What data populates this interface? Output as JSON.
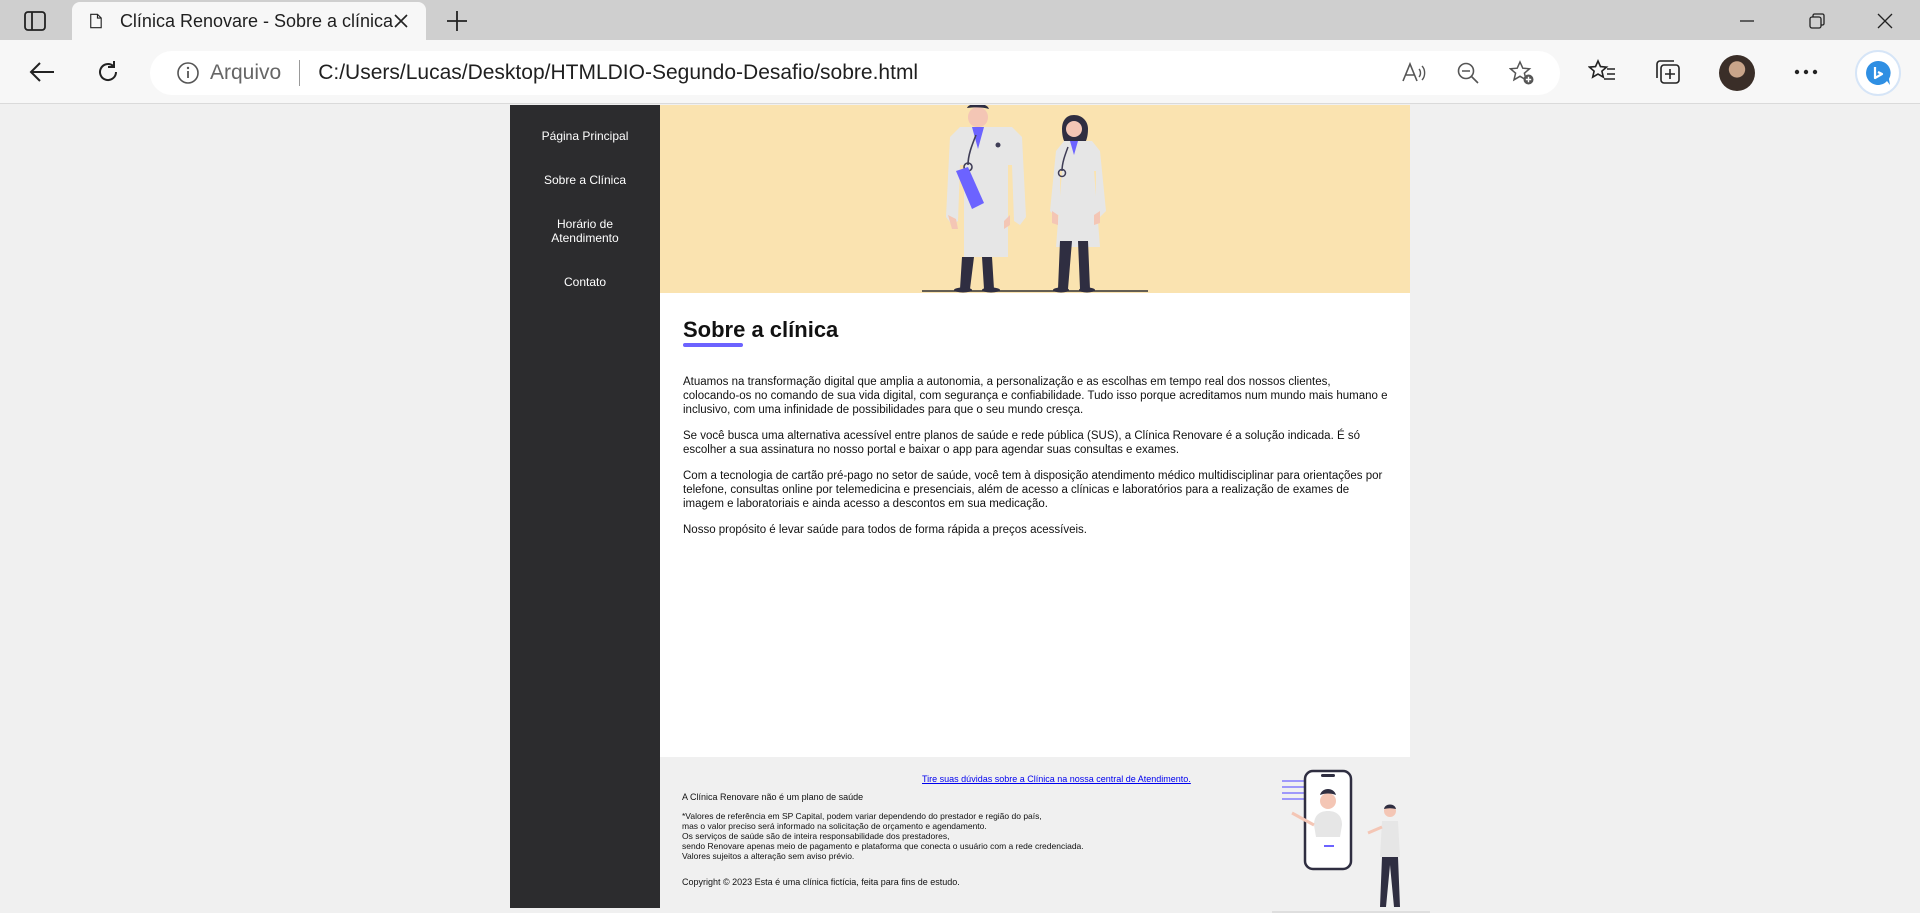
{
  "browser": {
    "tab_title": "Clínica Renovare - Sobre a clínica",
    "site_info_label": "Arquivo",
    "url": "C:/Users/Lucas/Desktop/HTMLDIO-Segundo-Desafio/sobre.html"
  },
  "nav": {
    "items": [
      {
        "label": "Página Principal"
      },
      {
        "label": "Sobre a Clínica"
      },
      {
        "label": "Horário de Atendimento"
      },
      {
        "label": "Contato"
      }
    ]
  },
  "main": {
    "heading": "Sobre a clínica",
    "paragraphs": [
      "Atuamos na transformação digital que amplia a autonomia, a personalização e as escolhas em tempo real dos nossos clientes, colocando-os no comando de sua vida digital, com segurança e confiabilidade. Tudo isso porque acreditamos num mundo mais humano e inclusivo, com uma infinidade de possibilidades para que o seu mundo cresça.",
      "Se você busca uma alternativa acessível entre planos de saúde e rede pública (SUS), a Clínica Renovare é a solução indicada. É só escolher a sua assinatura no nosso portal e baixar o app para agendar suas consultas e exames.",
      "Com a tecnologia de cartão pré-pago no setor de saúde, você tem à disposição atendimento médico multidisciplinar para orientações por telefone, consultas online por telemedicina e presenciais, além de acesso a clínicas e laboratórios para a realização de exames de imagem e laboratoriais e ainda acesso a descontos em sua medicação.",
      "Nosso propósito é levar saúde para todos de forma rápida a preços acessíveis."
    ]
  },
  "footer": {
    "link": "Tire suas dúvidas sobre a Clínica na nossa central de Atendimento.",
    "notice": "A Clínica Renovare não é um plano de saúde",
    "disclaimer": [
      "*Valores de referência em SP Capital, podem variar dependendo do prestador e região do país,",
      "mas o valor preciso será informado na solicitação de orçamento e agendamento.",
      "Os serviços de saúde são de inteira responsabilidade dos prestadores,",
      "sendo Renovare apenas meio de pagamento e plataforma que conecta o usuário com a rede credenciada.",
      "Valores sujeitos a alteração sem aviso prévio."
    ],
    "copyright": "Copyright © 2023 Esta é uma clínica fictícia, feita para fins de estudo."
  },
  "colors": {
    "sidebar": "#2c2c2e",
    "hero_background": "#fae3b0",
    "accent": "#6c63ff",
    "link": "#0000ee"
  }
}
